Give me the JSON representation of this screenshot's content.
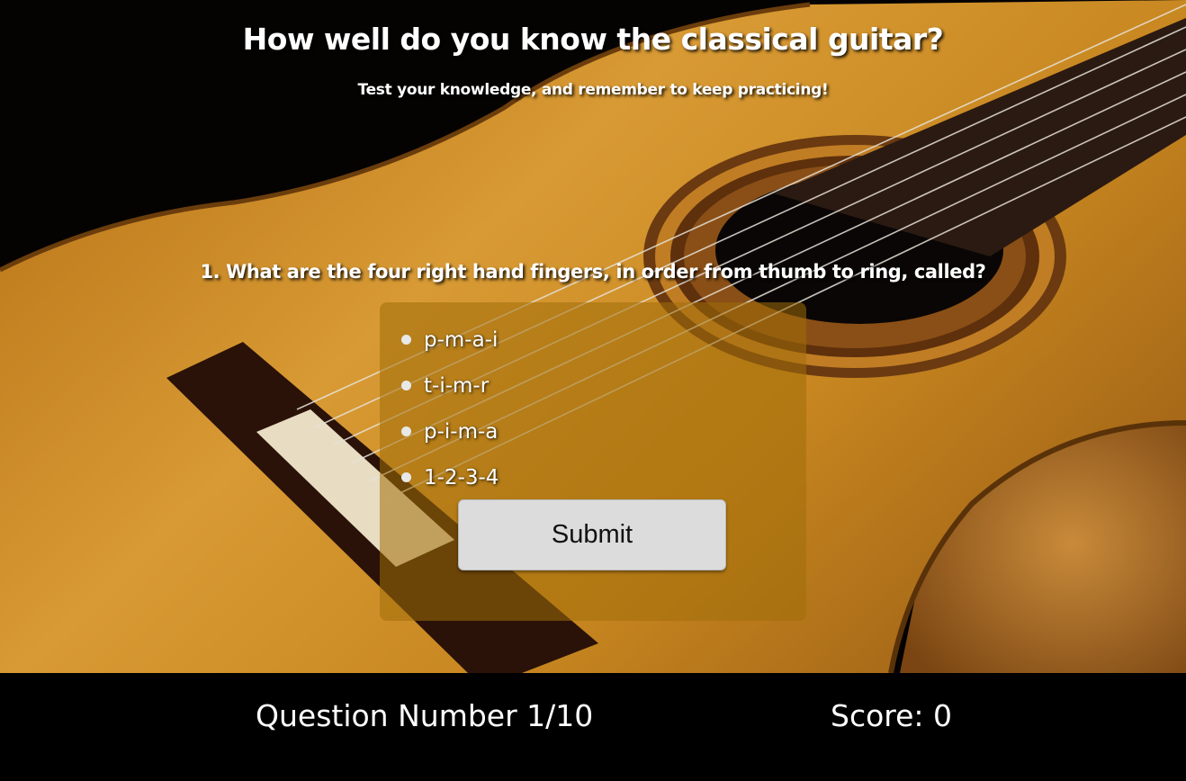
{
  "header": {
    "title": "How well do you know the classical guitar?",
    "subtitle": "Test your knowledge, and remember to keep practicing!"
  },
  "quiz": {
    "question": "1. What are the four right hand fingers, in order from thumb to ring, called?",
    "answers": [
      {
        "label": "p-m-a-i"
      },
      {
        "label": "t-i-m-r"
      },
      {
        "label": "p-i-m-a"
      },
      {
        "label": "1-2-3-4"
      }
    ],
    "submit_label": "Submit"
  },
  "footer": {
    "question_number": "Question Number 1/10",
    "score": "Score: 0"
  },
  "colors": {
    "background": "#000000",
    "panel": "#a06e0a",
    "button": "#dcdcdc",
    "wood": "#c98a22"
  }
}
